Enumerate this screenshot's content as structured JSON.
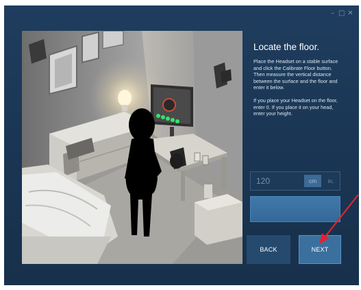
{
  "window": {
    "controls": [
      "–",
      "□",
      "✕"
    ]
  },
  "panel": {
    "title": "Locate the floor.",
    "paragraph1": "Place the Headset on a stable surface and click the Calibrate Floor button. Then measure the vertical distance between the surface and the floor and enter it below.",
    "paragraph2": "If you place your Headset on the floor, enter 0. If you place it on your head, enter your height.",
    "height_input": {
      "value": "120"
    },
    "units": {
      "cm": "cm",
      "in": "in.",
      "selected": "cm"
    },
    "back_label": "BACK",
    "next_label": "NEXT"
  },
  "colors": {
    "window_bg": "#1f3d5e",
    "accent": "#3b6f9e",
    "indicator": "#2ee86a",
    "annotation_arrow": "#e0242e"
  }
}
